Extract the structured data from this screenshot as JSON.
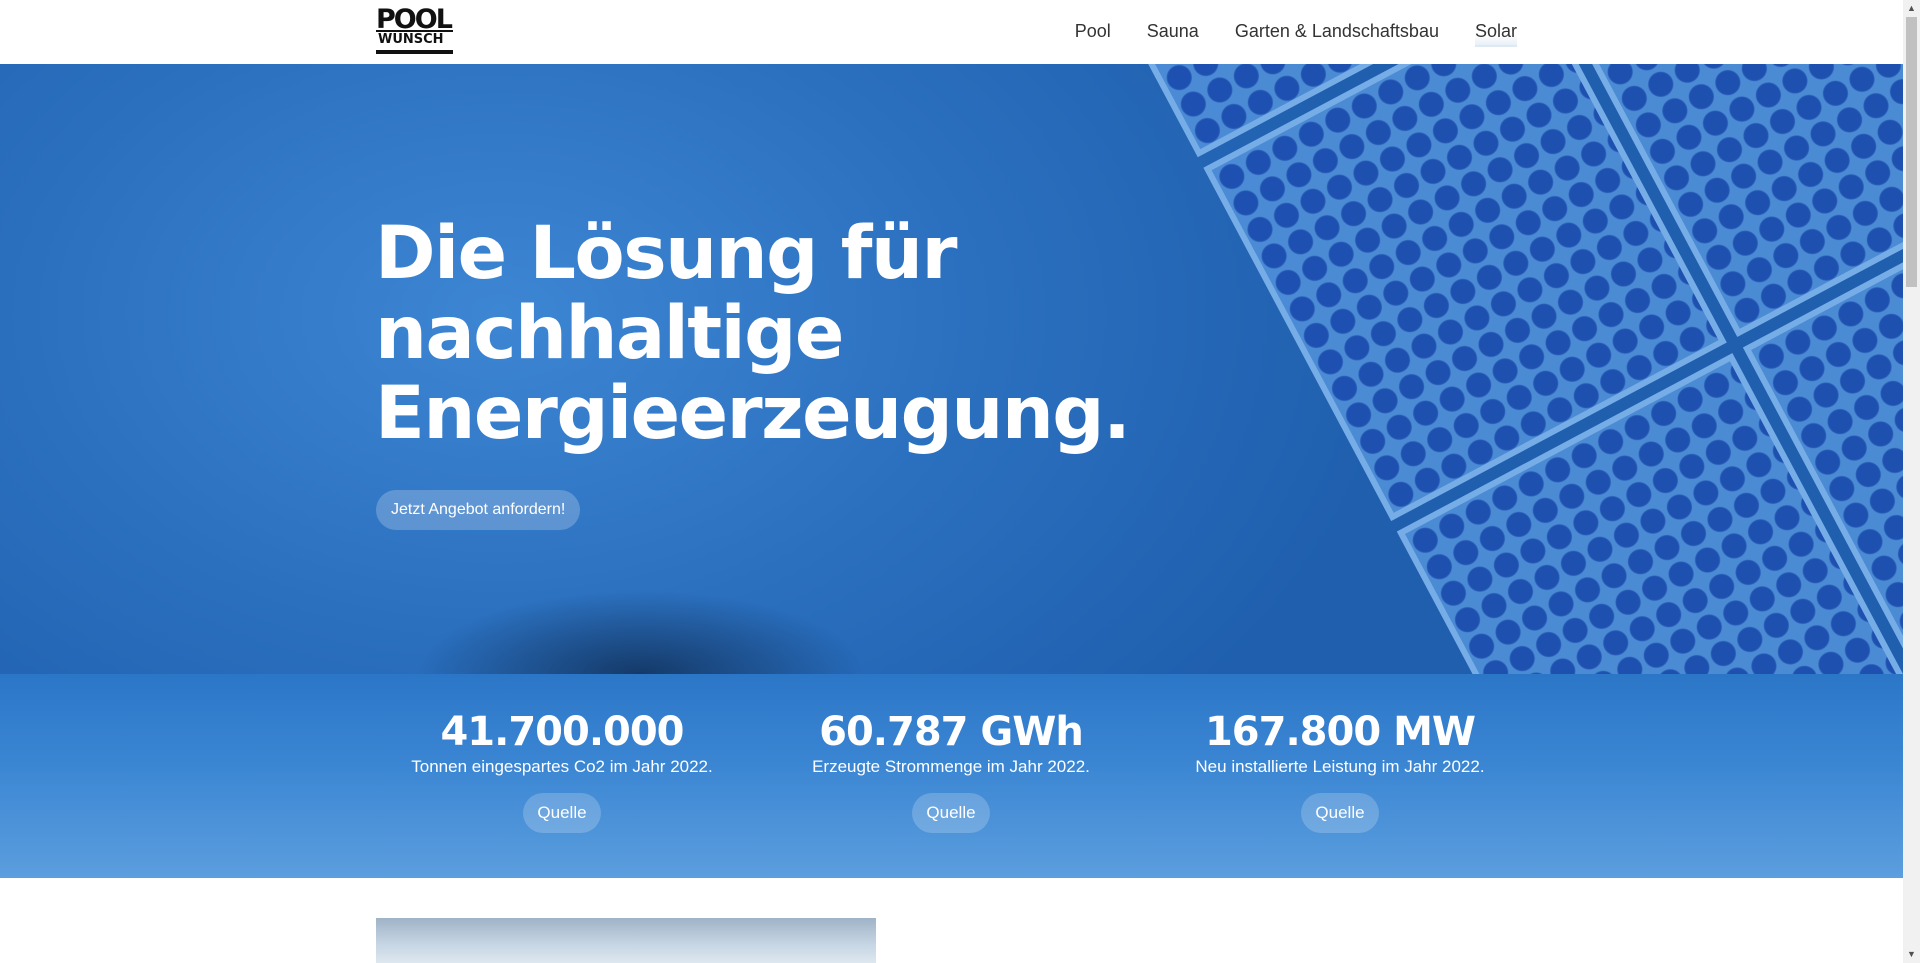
{
  "logo": {
    "line1": "POOL",
    "line2": "WUNSCH"
  },
  "nav": [
    {
      "label": "Pool"
    },
    {
      "label": "Sauna"
    },
    {
      "label": "Garten & Landschaftsbau"
    },
    {
      "label": "Solar"
    }
  ],
  "hero": {
    "title_line1": "Die Lösung für",
    "title_line2": "nachhaltige",
    "title_line3": "Energieerzeugung.",
    "cta": "Jetzt Angebot anfordern!"
  },
  "stats": [
    {
      "value": "41.700.000",
      "description": "Tonnen eingespartes Co2 im Jahr 2022.",
      "source": "Quelle"
    },
    {
      "value": "60.787 GWh",
      "description": "Erzeugte Strommenge im Jahr 2022.",
      "source": "Quelle"
    },
    {
      "value": "167.800 MW",
      "description": "Neu installierte Leistung im Jahr 2022.",
      "source": "Quelle"
    }
  ],
  "colors": {
    "hero_blue": "#2a6fbe",
    "text": "#333333",
    "white": "#ffffff"
  },
  "icons": {
    "scroll_up": "▲",
    "scroll_down": "▼"
  }
}
